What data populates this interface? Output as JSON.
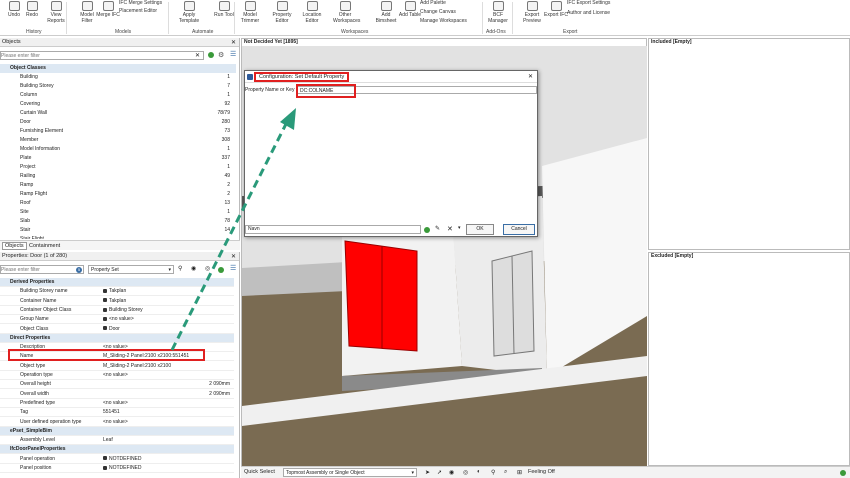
{
  "ribbon": {
    "buttons": [
      {
        "label": "Undo",
        "icon": "undo-icon"
      },
      {
        "label": "Redo",
        "icon": "redo-icon"
      },
      {
        "label": "View Reports",
        "icon": "report-icon"
      },
      {
        "label": "Model Filter",
        "icon": "filter-icon"
      },
      {
        "label": "Merge IFC",
        "icon": "merge-icon"
      },
      {
        "label": "Apply Template",
        "icon": "template-icon"
      },
      {
        "label": "Run Tool",
        "icon": "run-icon"
      },
      {
        "label": "Model Trimmer",
        "icon": "trim-icon"
      },
      {
        "label": "Property Editor",
        "icon": "property-icon"
      },
      {
        "label": "Location Editor",
        "icon": "location-icon"
      },
      {
        "label": "Other Workspaces",
        "icon": "workspace-icon"
      },
      {
        "label": "Add Bimsheet",
        "icon": "bimsheet-icon"
      },
      {
        "label": "Add Table",
        "icon": "table-icon"
      },
      {
        "label": "BCF Manager",
        "icon": "bcf-icon"
      },
      {
        "label": "Export Preview",
        "icon": "export-preview-icon"
      },
      {
        "label": "Export IFC",
        "icon": "ifc-icon"
      }
    ],
    "small": [
      "IFC Merge Settings",
      "Placement Editor",
      "Add Palette",
      "Change Canvas",
      "Manage Workspaces",
      "IFC Export Settings",
      "Author and License"
    ],
    "groups": [
      "History",
      "Models",
      "Automate",
      "Workspaces",
      "Add-Ons",
      "Export"
    ]
  },
  "objects": {
    "title": "Objects",
    "filter_placeholder": "Please enter filter",
    "rows": [
      {
        "name": "Object Classes",
        "count": "",
        "cls": "cat"
      },
      {
        "name": "Building",
        "count": "1"
      },
      {
        "name": "Building Storey",
        "count": "7"
      },
      {
        "name": "Column",
        "count": "1"
      },
      {
        "name": "Covering",
        "count": "92"
      },
      {
        "name": "Curtain Wall",
        "count": "78/79"
      },
      {
        "name": "Door",
        "count": "280"
      },
      {
        "name": "Furnishing Element",
        "count": "73"
      },
      {
        "name": "Member",
        "count": "308"
      },
      {
        "name": "Model Information",
        "count": "1"
      },
      {
        "name": "Plate",
        "count": "337"
      },
      {
        "name": "Project",
        "count": "1"
      },
      {
        "name": "Railing",
        "count": "49"
      },
      {
        "name": "Ramp",
        "count": "2"
      },
      {
        "name": "Ramp Flight",
        "count": "2"
      },
      {
        "name": "Roof",
        "count": "13"
      },
      {
        "name": "Site",
        "count": "1"
      },
      {
        "name": "Slab",
        "count": "78"
      },
      {
        "name": "Stair",
        "count": "14"
      },
      {
        "name": "Stair Flight",
        "count": ""
      }
    ],
    "tabs": [
      "Objects",
      "Containment"
    ]
  },
  "properties": {
    "title": "Properties: Door (1 of 280)",
    "filter_placeholder": "Please enter filter",
    "count_badge": "5",
    "property_set": "Property Set",
    "rows": [
      {
        "name": "Derived Properties",
        "value": "",
        "cls": "cat"
      },
      {
        "name": "Building Storey name",
        "value": "Takplan",
        "lock": true
      },
      {
        "name": "Container Name",
        "value": "Takplan",
        "lock": true
      },
      {
        "name": "Container Object Class",
        "value": "Building Storey",
        "lock": true
      },
      {
        "name": "Group Name",
        "value": "<no value>",
        "lock": true
      },
      {
        "name": "Object Class",
        "value": "Door",
        "lock": true
      },
      {
        "name": "Direct Properties",
        "value": "",
        "cls": "cat"
      },
      {
        "name": "Description",
        "value": "<no value>"
      },
      {
        "name": "Name",
        "value": "M_Sliding-2 Panel:2100 x2100:551451",
        "hl": true
      },
      {
        "name": "Object type",
        "value": "M_Sliding-2 Panel:2100 x2100"
      },
      {
        "name": "Operation type",
        "value": "<no value>"
      },
      {
        "name": "Overall height",
        "value": "2 090mm",
        "right": true
      },
      {
        "name": "Overall width",
        "value": "2 090mm",
        "right": true
      },
      {
        "name": "Predefined type",
        "value": "<no value>"
      },
      {
        "name": "Tag",
        "value": "551451"
      },
      {
        "name": "User defined operation type",
        "value": "<no value>"
      },
      {
        "name": "ePset_SimpleBim",
        "value": "",
        "cls": "cat"
      },
      {
        "name": "Assembly Level",
        "value": "Leaf"
      },
      {
        "name": "IfcDoorPanelProperties",
        "value": "",
        "cls": "cat"
      },
      {
        "name": "Panel operation",
        "value": "NOTDEFINED",
        "lock": true
      },
      {
        "name": "Panel position",
        "value": "NOTDEFINED",
        "lock": true
      }
    ]
  },
  "viewer": {
    "title": "Not Decided Yet [1895]"
  },
  "included": {
    "title": "Included [Empty]"
  },
  "excluded": {
    "title": "Excluded [Empty]"
  },
  "dialog": {
    "title": "Configuration: Set Default Property",
    "label": "Property Name or Key",
    "value": "DC:COLNAME",
    "bottom_input": "Navn",
    "ok": "OK",
    "cancel": "Cancel"
  },
  "status": {
    "quick_select": "Quick Select",
    "mode": "Topmost Assembly or Single Object",
    "feeling": "Feeling Off"
  }
}
